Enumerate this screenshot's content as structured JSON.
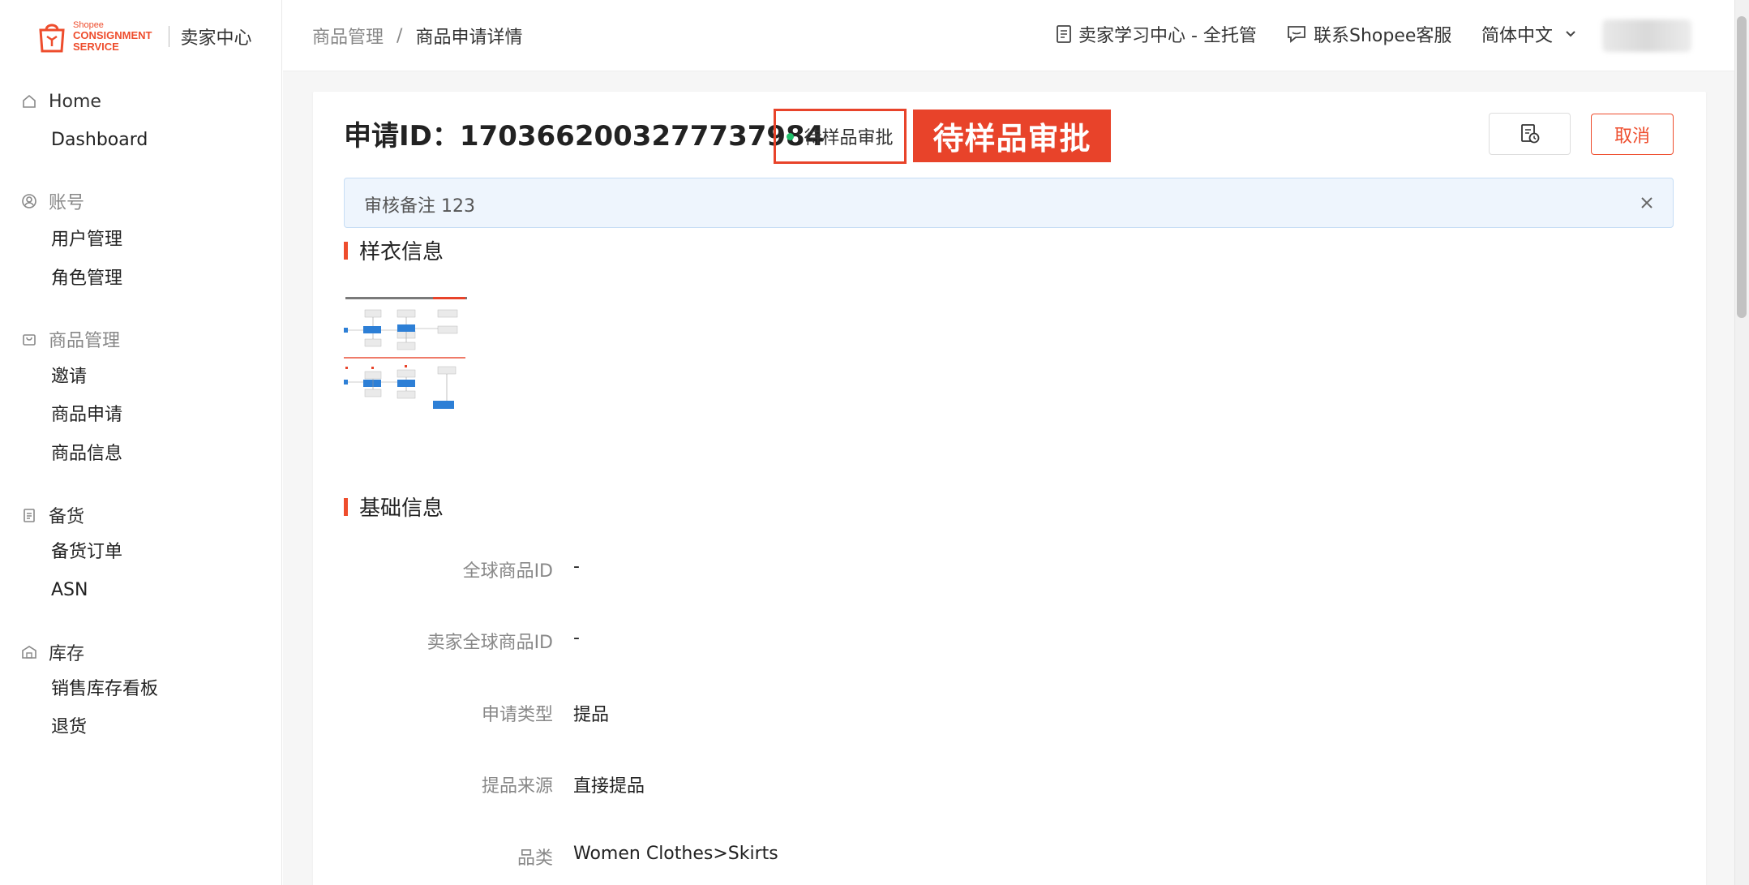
{
  "brand": {
    "logo_line1": "Shopee",
    "logo_line2": "CONSIGNMENT",
    "logo_line3": "SERVICE",
    "title": "卖家中心",
    "accent_color": "#ee4d2d"
  },
  "sidebar": {
    "groups": [
      {
        "label": "Home",
        "icon": "home-icon",
        "items": [
          "Dashboard"
        ]
      },
      {
        "label": "账号",
        "icon": "user-circle-icon",
        "items": [
          "用户管理",
          "角色管理"
        ]
      },
      {
        "label": "商品管理",
        "icon": "bag-icon",
        "items": [
          "邀请",
          "商品申请",
          "商品信息"
        ]
      },
      {
        "label": "备货",
        "icon": "clipboard-icon",
        "items": [
          "备货订单",
          "ASN"
        ]
      },
      {
        "label": "库存",
        "icon": "warehouse-icon",
        "items": [
          "销售库存看板",
          "退货"
        ]
      }
    ]
  },
  "topbar": {
    "breadcrumb": [
      "商品管理",
      "商品申请详情"
    ],
    "breadcrumb_sep": "/",
    "learning_center": "卖家学习中心 - 全托管",
    "contact_service": "联系Shopee客服",
    "language": "简体中文"
  },
  "header": {
    "request_id_label": "申请ID：",
    "request_id": "1703662003277737984",
    "status": "待样品审批",
    "status_callout": "待样品审批",
    "status_dot_color": "#1ec06a",
    "cancel_label": "取消"
  },
  "alert": {
    "text": "审核备注 123"
  },
  "sections": {
    "sample_info": "样衣信息",
    "basic_info": "基础信息"
  },
  "basic_fields": [
    {
      "label": "全球商品ID",
      "value": "-"
    },
    {
      "label": "卖家全球商品ID",
      "value": "-"
    },
    {
      "label": "申请类型",
      "value": "提品"
    },
    {
      "label": "提品来源",
      "value": "直接提品"
    },
    {
      "label": "品类",
      "value": "Women Clothes>Skirts"
    }
  ]
}
